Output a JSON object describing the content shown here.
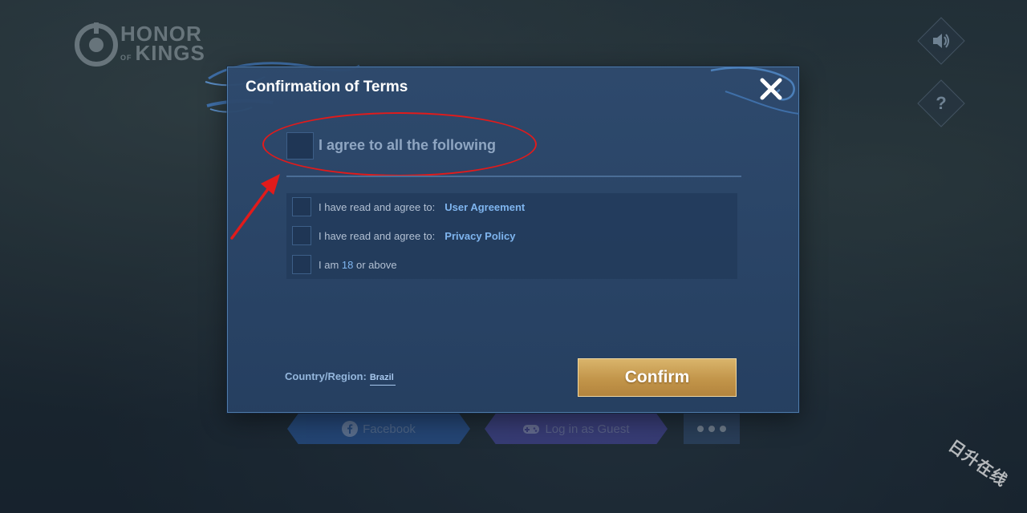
{
  "background": {
    "logo": {
      "line1": "HONOR",
      "of": "OF",
      "line2": "KINGS"
    },
    "side_icons": [
      "speaker-icon",
      "question-icon"
    ],
    "buttons": {
      "facebook_label": "Facebook",
      "guest_label": "Log in as Guest"
    }
  },
  "dialog": {
    "title": "Confirmation of Terms",
    "close_icon": "close-icon",
    "agree_all_label": "I agree to all the following",
    "terms": [
      {
        "prefix": "I have read and agree to:",
        "link": "User Agreement"
      },
      {
        "prefix": "I have read and agree to:",
        "link": "Privacy Policy"
      }
    ],
    "age_term": {
      "before": "I am ",
      "number": "18",
      "after": " or above"
    },
    "country_label": "Country/Region:",
    "country_value": "Brazil",
    "confirm_label": "Confirm"
  },
  "annotation": {
    "color": "#e11b1b"
  },
  "watermark": "日升在线",
  "colors": {
    "accent_gold": "#c9a058",
    "link_blue": "#7fb5ef",
    "dialog_bg": "#2e4a6e"
  }
}
